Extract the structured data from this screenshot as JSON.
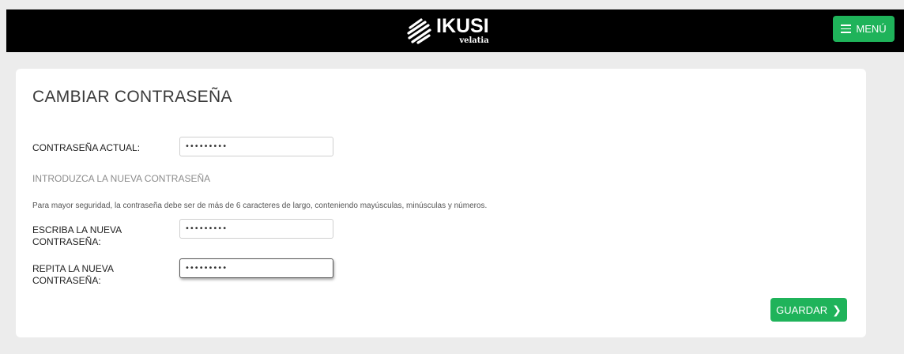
{
  "header": {
    "logo": {
      "brand": "IKUSI",
      "sub": "velatia",
      "icon": "ikusi-logo-icon"
    },
    "menu_button": {
      "label": "MENÚ",
      "icon": "hamburger-icon"
    }
  },
  "form": {
    "title": "CAMBIAR CONTRASEÑA",
    "current_password": {
      "label": "CONTRASEÑA ACTUAL:",
      "value": "•••••••••"
    },
    "section_heading": "INTRODUZCA LA NUEVA CONTRASEÑA",
    "hint": "Para mayor seguridad, la contraseña debe ser de más de 6 caracteres de largo, conteniendo mayúsculas, minúsculas y números.",
    "new_password": {
      "label_line1": "ESCRIBA LA NUEVA",
      "label_line2": "CONTRASEÑA:",
      "value": "•••••••••"
    },
    "repeat_password": {
      "label_line1": "REPITA LA NUEVA",
      "label_line2": "CONTRASEÑA:",
      "value": "•••••••••"
    },
    "save_button": {
      "label": "GUARDAR",
      "icon": "chevron-right-icon"
    }
  },
  "colors": {
    "accent": "#1fb35a",
    "header_bg": "#000000",
    "page_bg": "#ececec"
  }
}
